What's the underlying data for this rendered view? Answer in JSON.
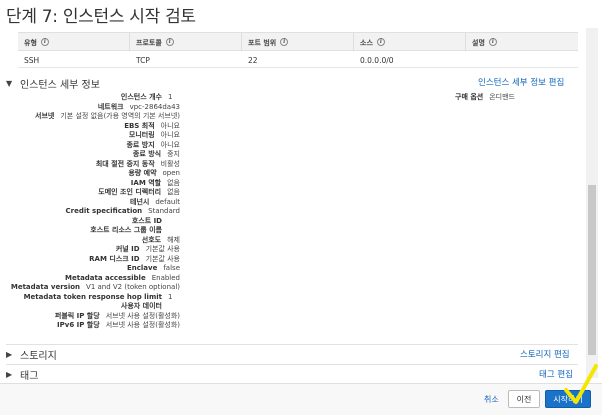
{
  "page_title": "단계 7: 인스턴스 시작 검토",
  "rules_table": {
    "headers": [
      "유형",
      "프로토콜",
      "포트 범위",
      "소스",
      "설명"
    ],
    "rows": [
      [
        "SSH",
        "TCP",
        "22",
        "0.0.0.0/0",
        ""
      ]
    ]
  },
  "instance_details": {
    "section_title": "인스턴스 세부 정보",
    "edit_link": "인스턴스 세부 정보 편집",
    "rows": [
      {
        "label": "인스턴스 개수",
        "value": "1"
      },
      {
        "label": "네트워크",
        "value": "vpc-2864da43"
      },
      {
        "label": "서브넷",
        "value": "기본 설정 없음(가용 영역의 기본 서브넷)"
      },
      {
        "label": "EBS 최적",
        "value": "아니요"
      },
      {
        "label": "모니터링",
        "value": "아니요"
      },
      {
        "label": "종료 방지",
        "value": "아니요"
      },
      {
        "label": "종료 방식",
        "value": "중지"
      },
      {
        "label": "최대 절전 중지 동작",
        "value": "비활성"
      },
      {
        "label": "용량 예약",
        "value": "open"
      },
      {
        "label": "IAM 역할",
        "value": "없음"
      },
      {
        "label": "도메인 조인 디렉터리",
        "value": "없음"
      },
      {
        "label": "테넌시",
        "value": "default"
      },
      {
        "label": "Credit specification",
        "value": "Standard"
      },
      {
        "label": "호스트 ID",
        "value": ""
      },
      {
        "label": "호스트 리소스 그룹 이름",
        "value": ""
      },
      {
        "label": "선호도",
        "value": "해제"
      },
      {
        "label": "커널 ID",
        "value": "기본값 사용"
      },
      {
        "label": "RAM 디스크 ID",
        "value": "기본값 사용"
      },
      {
        "label": "Enclave",
        "value": "false"
      },
      {
        "label": "Metadata accessible",
        "value": "Enabled"
      },
      {
        "label": "Metadata version",
        "value": "V1 and V2 (token optional)"
      },
      {
        "label": "Metadata token response hop limit",
        "value": "1"
      },
      {
        "label": "사용자 데이터",
        "value": ""
      },
      {
        "label": "퍼블릭 IP 할당",
        "value": "서브넷 사용 설정(활성화)"
      },
      {
        "label": "IPv6 IP 할당",
        "value": "서브넷 사용 설정(활성화)"
      }
    ],
    "purchase_option": {
      "label": "구매 옵션",
      "value": "온디맨드"
    }
  },
  "storage": {
    "section_title": "스토리지",
    "edit_link": "스토리지 편집"
  },
  "tags": {
    "section_title": "태그",
    "edit_link": "태그 편집"
  },
  "footer": {
    "cancel": "취소",
    "previous": "이전",
    "launch": "시작하기"
  },
  "colors": {
    "link": "#1166bb",
    "primary_button": "#1a73c8",
    "annotation": "#f5e600"
  },
  "icons": {
    "info": "info-icon",
    "expanded": "caret-down-icon",
    "collapsed": "caret-right-icon"
  }
}
